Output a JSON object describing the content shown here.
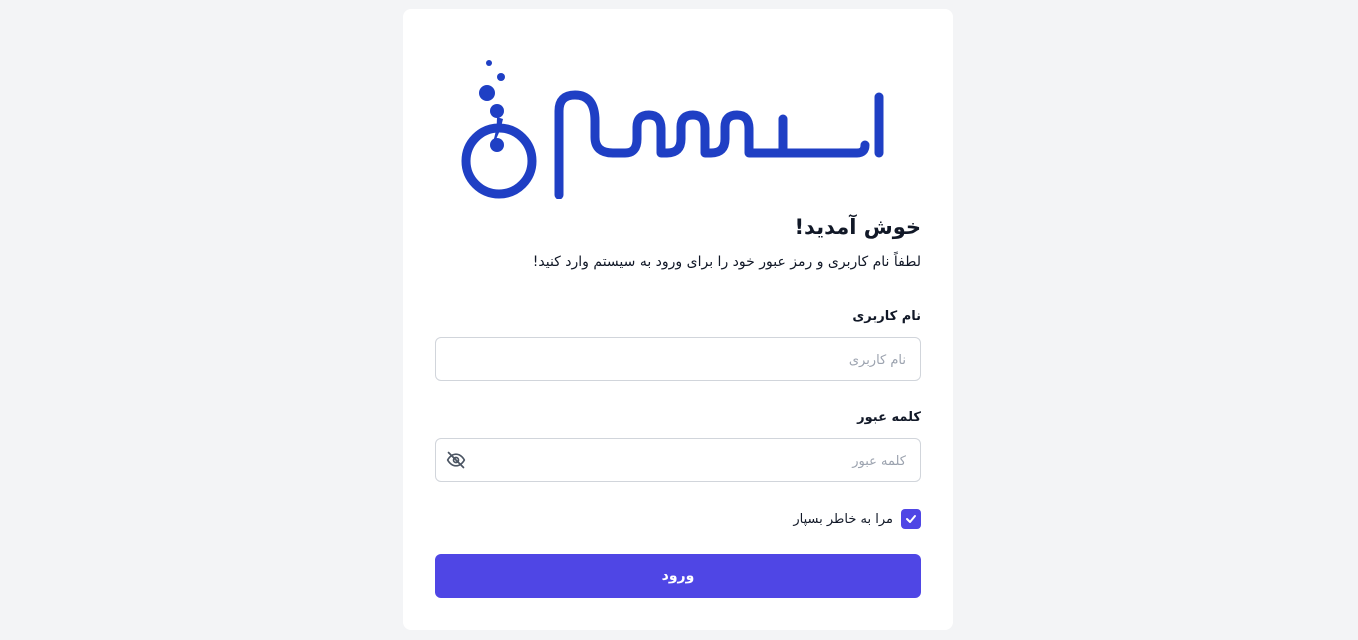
{
  "logo": {
    "name": "logo-mark",
    "color": "#1f3fc4"
  },
  "welcome_title": "خوش آمدید!",
  "welcome_subtitle": "لطفاً نام کاربری و رمز عبور خود را برای ورود به سیستم وارد کنید!",
  "username": {
    "label": "نام کاربری",
    "placeholder": "نام کاربری",
    "value": ""
  },
  "password": {
    "label": "کلمه عبور",
    "placeholder": "کلمه عبور",
    "value": "",
    "toggle_icon": "eye-off-icon"
  },
  "remember": {
    "label": "مرا به خاطر بسپار",
    "checked": true
  },
  "submit_label": "ورود",
  "colors": {
    "primary": "#4f46e5",
    "logo": "#1f3fc4",
    "background": "#f3f4f6"
  }
}
